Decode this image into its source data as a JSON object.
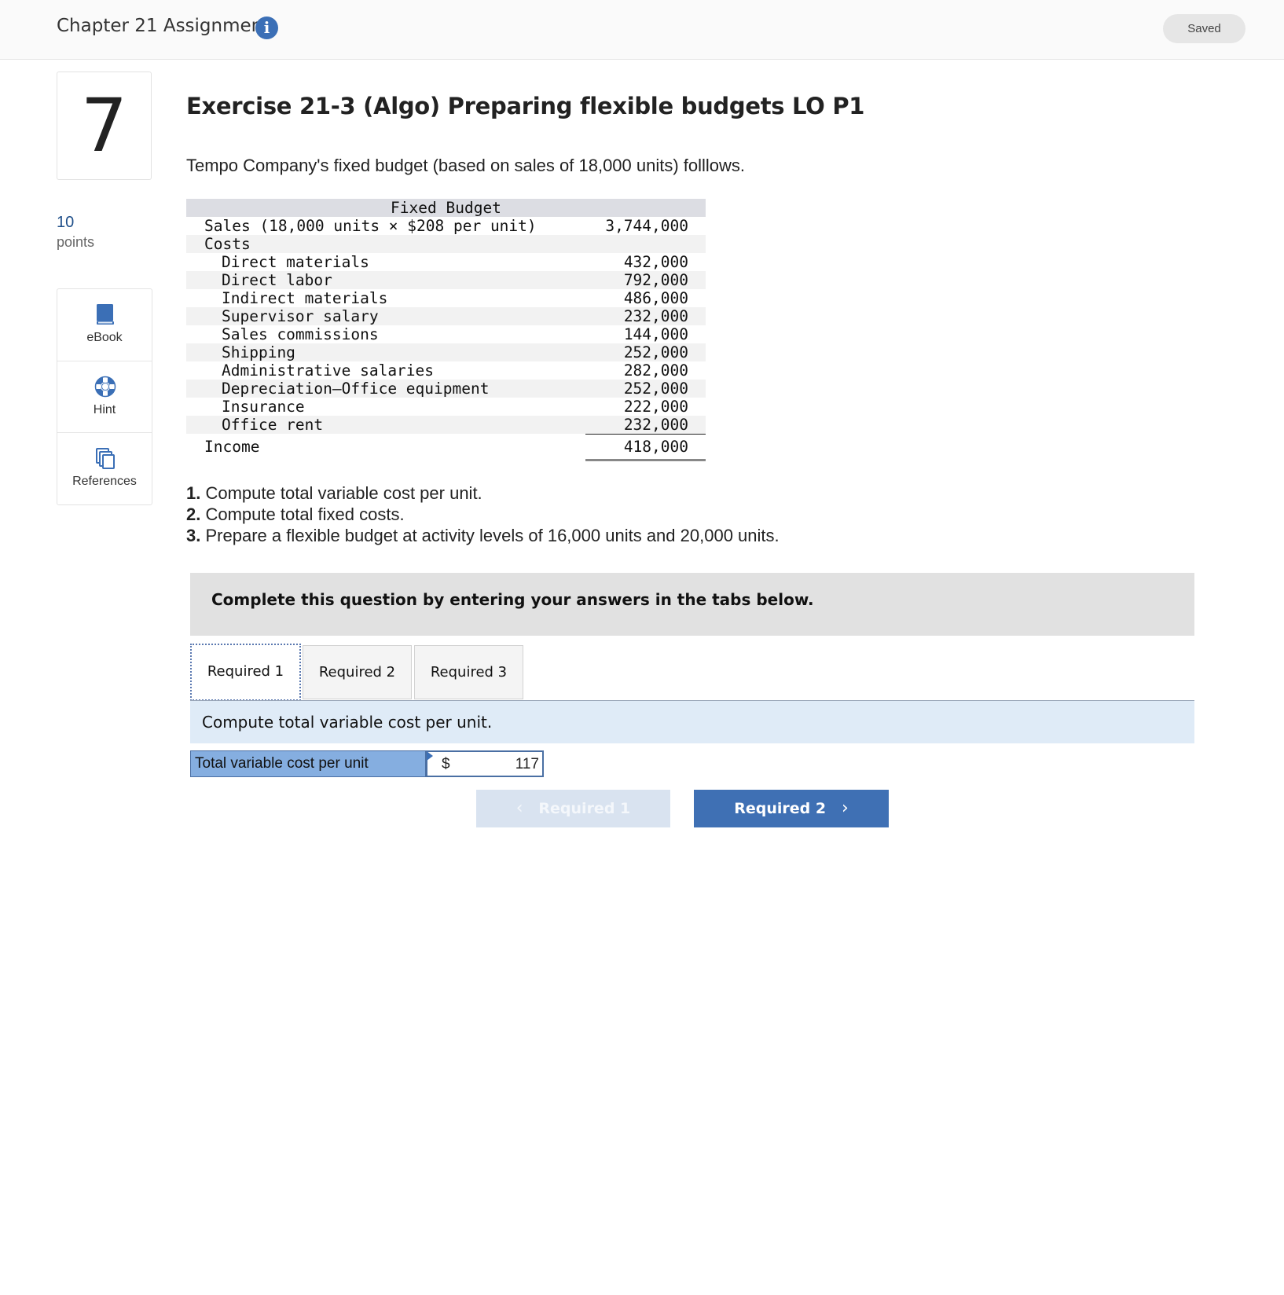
{
  "header": {
    "title": "Chapter 21 Assignment",
    "info_icon": "i",
    "saved_label": "Saved"
  },
  "question": {
    "number": "7",
    "points_value": "10",
    "points_label": "points"
  },
  "tools": [
    {
      "label": "eBook",
      "icon": "book-icon"
    },
    {
      "label": "Hint",
      "icon": "lifebuoy-icon"
    },
    {
      "label": "References",
      "icon": "copy-icon"
    }
  ],
  "exercise": {
    "title": "Exercise 21-3 (Algo) Preparing flexible budgets LO P1",
    "intro": "Tempo Company's fixed budget (based on sales of 18,000 units) folllows."
  },
  "budget": {
    "heading": "Fixed Budget",
    "sales_label": "Sales (18,000 units × $208 per unit)",
    "sales_value": "3,744,000",
    "costs_label": "Costs",
    "rows": [
      {
        "label": "Direct materials",
        "value": "432,000"
      },
      {
        "label": "Direct labor",
        "value": "792,000"
      },
      {
        "label": "Indirect materials",
        "value": "486,000"
      },
      {
        "label": "Supervisor salary",
        "value": "232,000"
      },
      {
        "label": "Sales commissions",
        "value": "144,000"
      },
      {
        "label": "Shipping",
        "value": "252,000"
      },
      {
        "label": "Administrative salaries",
        "value": "282,000"
      },
      {
        "label": "Depreciation—Office equipment",
        "value": "252,000"
      },
      {
        "label": "Insurance",
        "value": "222,000"
      },
      {
        "label": "Office rent",
        "value": "232,000"
      }
    ],
    "income_label": "Income",
    "income_value": "418,000"
  },
  "requirements": [
    {
      "num": "1.",
      "text": "Compute total variable cost per unit."
    },
    {
      "num": "2.",
      "text": "Compute total fixed costs."
    },
    {
      "num": "3.",
      "text": "Prepare a flexible budget at activity levels of 16,000 units and 20,000 units."
    }
  ],
  "instructions": "Complete this question by entering your answers in the tabs below.",
  "tabs": [
    "Required 1",
    "Required 2",
    "Required 3"
  ],
  "active_tab": "Required 1",
  "req_prompt": "Compute total variable cost per unit.",
  "answer": {
    "label": "Total variable cost per unit",
    "currency": "$",
    "value": "117"
  },
  "nav": {
    "prev_label": "Required 1",
    "next_label": "Required 2",
    "prev_chevron": "‹",
    "next_chevron": "›"
  },
  "colors": {
    "accent": "#3f70b4",
    "answer_label_bg": "#85aee0",
    "prompt_strip_bg": "#dfebf7"
  }
}
